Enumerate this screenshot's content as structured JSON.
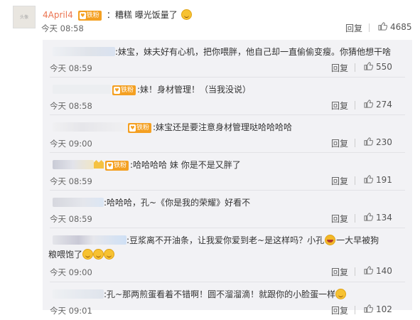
{
  "main": {
    "avatar_text": "头像",
    "username": "4April4",
    "badge": "铁粉",
    "text": "：糟糕 曝光饭量了",
    "time": "今天 08:58",
    "reply_label": "回复",
    "like_count": "4685"
  },
  "replies": [
    {
      "badge": "",
      "text": ":妹宝，妹夫好有心机，把你喂胖，他自己却一直偷偷变瘦。你猜他想干啥",
      "time": "今天 08:59",
      "reply_label": "回复",
      "like_count": "550"
    },
    {
      "badge": "铁粉",
      "text": ":妹！身材管理！（当我没说）",
      "time": "今天 08:58",
      "reply_label": "回复",
      "like_count": "274"
    },
    {
      "badge": "铁粉",
      "text": ":妹宝还是要注意身材管理哒哈哈哈哈",
      "time": "今天 09:00",
      "reply_label": "回复",
      "like_count": "230"
    },
    {
      "badge": "铁粉",
      "text": ":哈哈哈哈 妹 你是不是又胖了",
      "time": "今天 08:59",
      "reply_label": "回复",
      "like_count": "191"
    },
    {
      "badge": "",
      "text": ":哈哈哈，孔~《你是我的荣耀》好看不",
      "time": "今天 08:59",
      "reply_label": "回复",
      "like_count": "134"
    },
    {
      "badge": "",
      "text": ":豆浆离不开油条，让我爱你爱到老~是这样吗？小孔",
      "text2": "一大早被狗",
      "text3": "粮喂饱了",
      "time": "今天 09:00",
      "reply_label": "回复",
      "like_count": "140"
    },
    {
      "badge": "",
      "text": ":孔~那两煎蛋看着不错啊！圆不溜溜滴！就跟你的小脸蛋一样",
      "time": "今天 09:01",
      "reply_label": "回复",
      "like_count": "102"
    }
  ],
  "colors": {
    "username": "#eb7350",
    "badge": "#f4a022",
    "reply_bg": "#f2f2f5"
  },
  "icons": [
    "thumb-up-icon",
    "smile-emoji",
    "laugh-emoji"
  ]
}
